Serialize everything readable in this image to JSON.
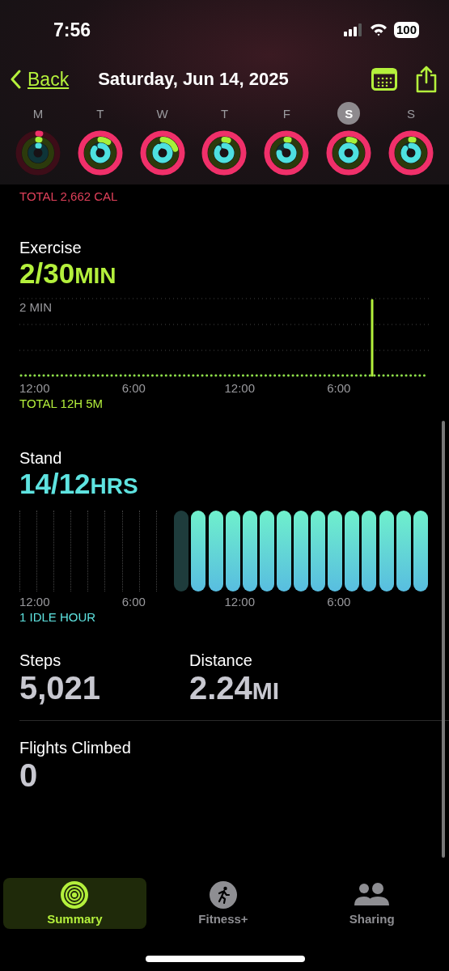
{
  "status_bar": {
    "time": "7:56",
    "battery": "100"
  },
  "nav": {
    "back": "Back",
    "title": "Saturday, Jun 14, 2025"
  },
  "week": [
    {
      "letter": "M",
      "selected": false
    },
    {
      "letter": "T",
      "selected": false
    },
    {
      "letter": "W",
      "selected": false
    },
    {
      "letter": "T",
      "selected": false
    },
    {
      "letter": "F",
      "selected": false
    },
    {
      "letter": "S",
      "selected": true
    },
    {
      "letter": "S",
      "selected": false
    }
  ],
  "move": {
    "total": "TOTAL 2,662 CAL"
  },
  "exercise": {
    "label": "Exercise",
    "value": "2/30",
    "unit": "MIN",
    "scale": "2 MIN",
    "axis": [
      "12:00",
      "6:00",
      "12:00",
      "6:00"
    ],
    "total": "TOTAL 12H 5M"
  },
  "stand": {
    "label": "Stand",
    "value": "14/12",
    "unit": "HRS",
    "axis": [
      "12:00",
      "6:00",
      "12:00",
      "6:00"
    ],
    "total": "1 IDLE HOUR",
    "hours": [
      {
        "kind": "none"
      },
      {
        "kind": "none"
      },
      {
        "kind": "none"
      },
      {
        "kind": "none"
      },
      {
        "kind": "none"
      },
      {
        "kind": "none"
      },
      {
        "kind": "none"
      },
      {
        "kind": "none"
      },
      {
        "kind": "none"
      },
      {
        "kind": "idle"
      },
      {
        "kind": "stood"
      },
      {
        "kind": "stood"
      },
      {
        "kind": "stood"
      },
      {
        "kind": "stood"
      },
      {
        "kind": "stood"
      },
      {
        "kind": "stood"
      },
      {
        "kind": "stood"
      },
      {
        "kind": "stood"
      },
      {
        "kind": "stood"
      },
      {
        "kind": "stood"
      },
      {
        "kind": "stood"
      },
      {
        "kind": "stood"
      },
      {
        "kind": "stood"
      },
      {
        "kind": "stood"
      }
    ]
  },
  "metrics": [
    {
      "label": "Steps",
      "value": "5,021"
    },
    {
      "label": "Distance",
      "value": "2.24",
      "unit": "MI"
    },
    {
      "label": "Flights Climbed",
      "value": "0"
    }
  ],
  "tabs": [
    {
      "label": "Summary",
      "kind": "summary",
      "selected": true
    },
    {
      "label": "Fitness+",
      "kind": "fitness",
      "selected": false
    },
    {
      "label": "Sharing",
      "kind": "sharing",
      "selected": false
    }
  ]
}
